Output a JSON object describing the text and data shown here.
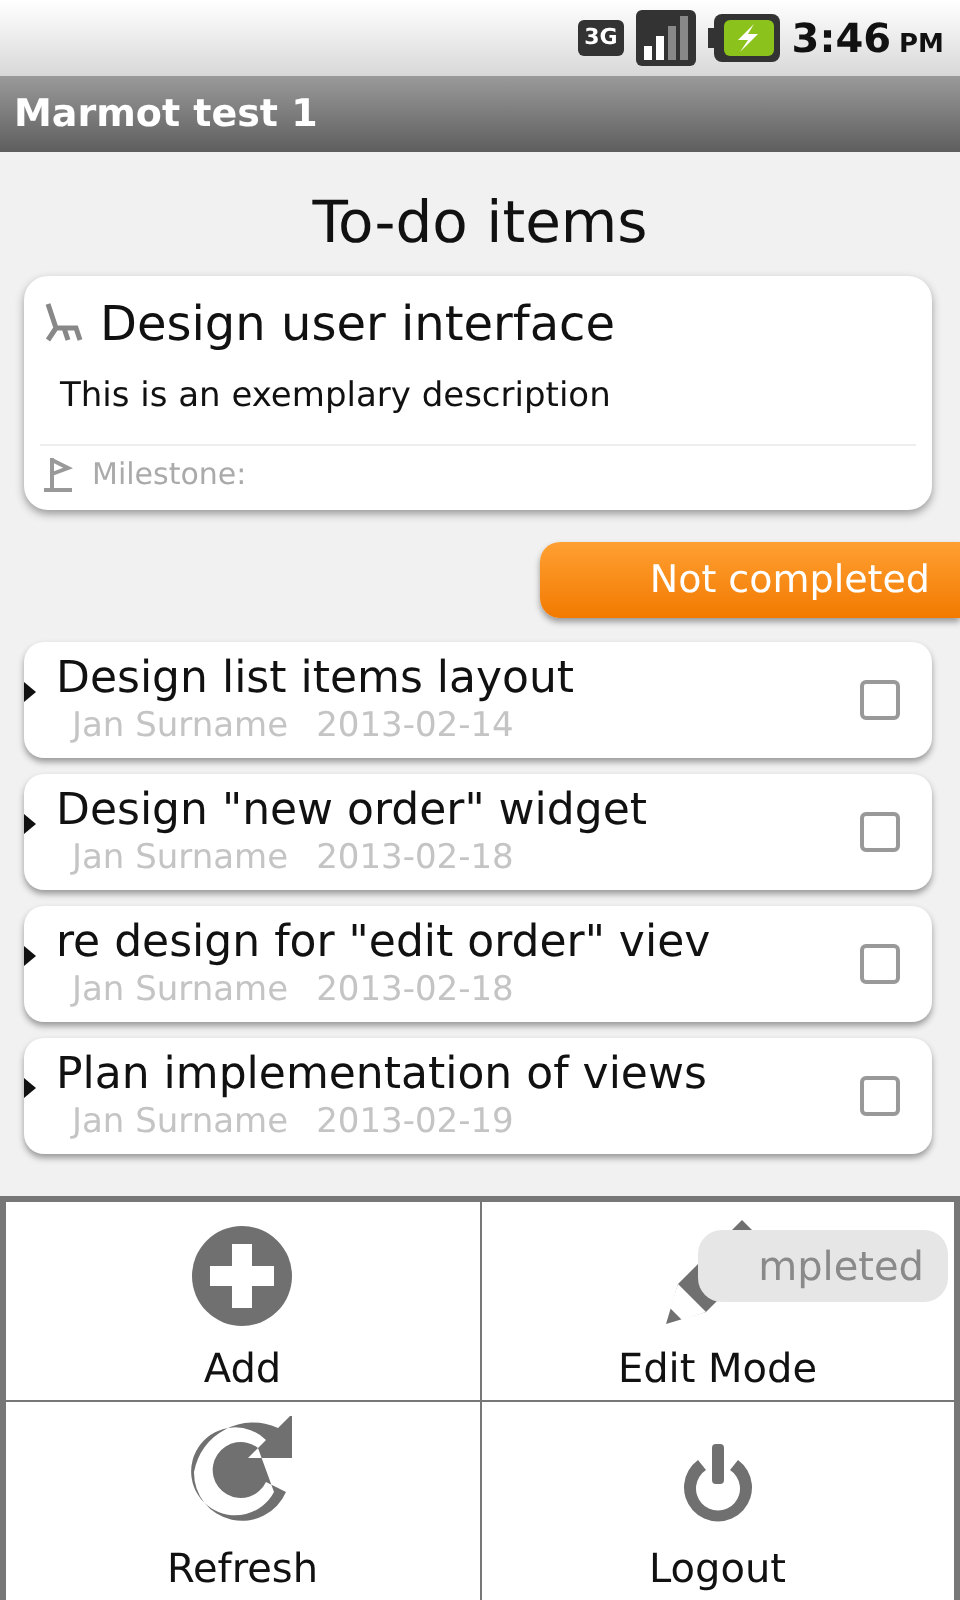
{
  "status_bar": {
    "network": "3G",
    "time": "3:46",
    "ampm": "PM"
  },
  "window": {
    "title": "Marmot test 1"
  },
  "heading": "To-do items",
  "detail_card": {
    "title": "Design user interface",
    "description": "This is an exemplary description",
    "milestone_label": "Milestone:"
  },
  "not_completed_header": {
    "label": "Not completed"
  },
  "items": [
    {
      "title": "Design list items layout",
      "author": "Jan Surname",
      "date": "2013-02-14",
      "checked": false
    },
    {
      "title": "Design \"new order\" widget",
      "author": "Jan Surname",
      "date": "2013-02-18",
      "checked": false
    },
    {
      "title": "re design for \"edit order\" viev",
      "author": "Jan Surname",
      "date": "2013-02-18",
      "checked": false
    },
    {
      "title": "Plan implementation of views",
      "author": "Jan Surname",
      "date": "2013-02-19",
      "checked": false
    }
  ],
  "completed_header": {
    "label": "mpleted"
  },
  "menu": [
    {
      "label": "Add",
      "kind": "add"
    },
    {
      "label": "Edit Mode",
      "kind": "edit"
    },
    {
      "label": "Refresh",
      "kind": "refresh"
    },
    {
      "label": "Logout",
      "kind": "logout"
    }
  ]
}
